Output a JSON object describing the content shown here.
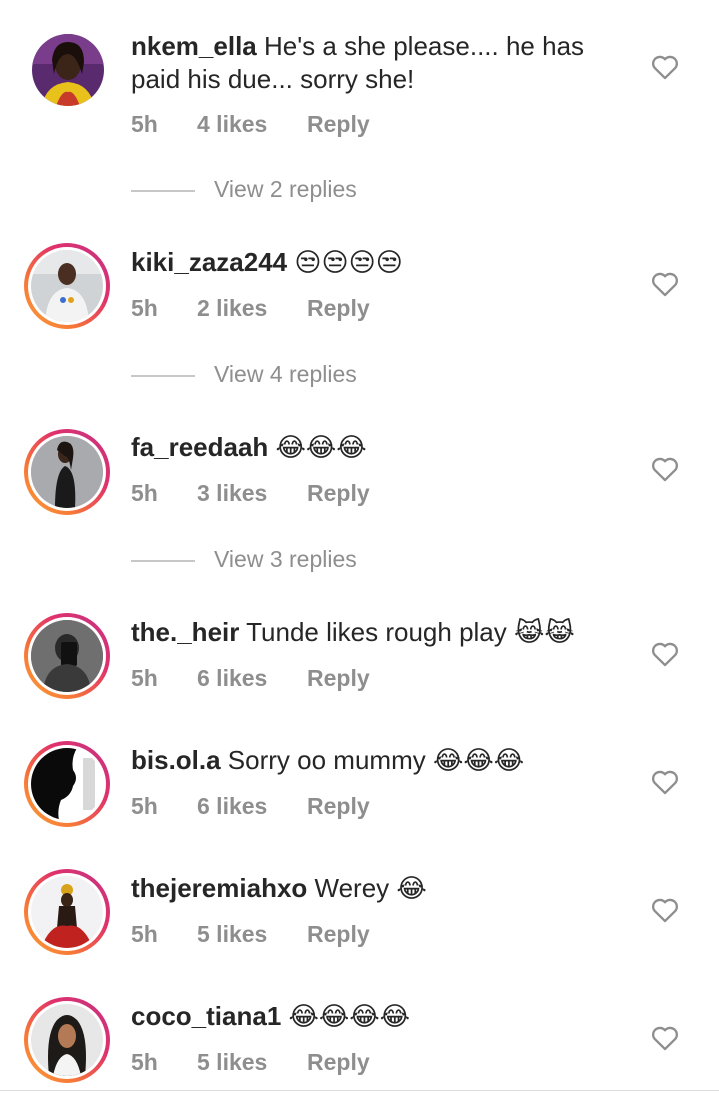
{
  "comments": [
    {
      "username": "nkem_ella",
      "text_line1": " He's a she please.... he has",
      "text_line2": "paid his due... sorry she!",
      "emoji": "",
      "time": "5h",
      "likes": "4 likes",
      "reply": "Reply",
      "replies_label": "View 2 replies",
      "avatar": "woman-yellow-outfit",
      "story_ring": false
    },
    {
      "username": "kiki_zaza244",
      "text_line1": " ",
      "emoji": "😒😒😒😒",
      "time": "5h",
      "likes": "2 likes",
      "reply": "Reply",
      "replies_label": "View 4 replies",
      "avatar": "man-white-shirt",
      "story_ring": true
    },
    {
      "username": "fa_reedaah",
      "text_line1": " ",
      "emoji": "😂😂😂",
      "time": "5h",
      "likes": "3 likes",
      "reply": "Reply",
      "replies_label": "View 3 replies",
      "avatar": "woman-black-outfit",
      "story_ring": true
    },
    {
      "username": "the._heir",
      "text_line1": " Tunde likes rough play ",
      "emoji": "😹😹",
      "time": "5h",
      "likes": "6 likes",
      "reply": "Reply",
      "avatar": "person-mirror-selfie",
      "story_ring": true
    },
    {
      "username": "bis.ol.a",
      "text_line1": " Sorry oo mummy ",
      "emoji": "😂😂😂",
      "time": "5h",
      "likes": "6 likes",
      "reply": "Reply",
      "avatar": "silhouette-profile",
      "story_ring": true
    },
    {
      "username": "thejeremiahxo",
      "text_line1": " Werey ",
      "emoji": "😂",
      "time": "5h",
      "likes": "5 likes",
      "reply": "Reply",
      "avatar": "person-red-cape",
      "story_ring": true
    },
    {
      "username": "coco_tiana1",
      "text_line1": " ",
      "emoji": "😂😂😂😂",
      "time": "5h",
      "likes": "5 likes",
      "reply": "Reply",
      "avatar": "woman-long-hair",
      "story_ring": true
    }
  ],
  "icons": {
    "like": "heart-outline-icon"
  },
  "colors": {
    "meta_text": "#8e8e8e",
    "primary_text": "#262626",
    "story_ring_start": "#f9a13b",
    "story_ring_end": "#c13584"
  }
}
